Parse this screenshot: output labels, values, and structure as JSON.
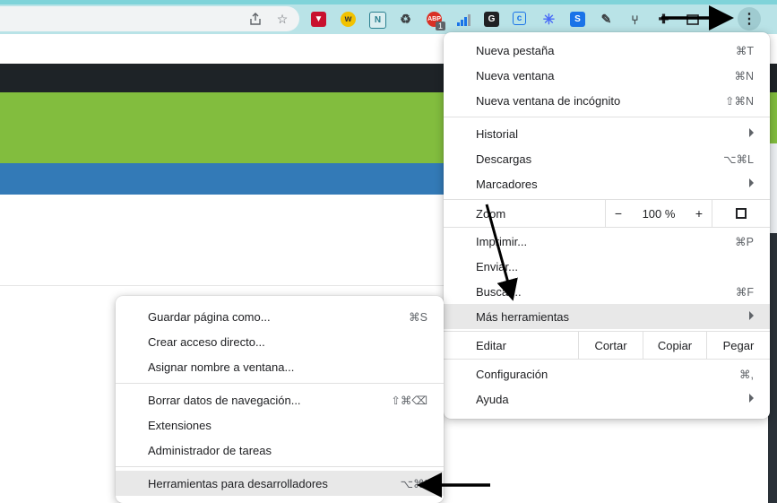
{
  "toolbar": {
    "share_icon": "share-icon",
    "bookmark_icon": "star-icon",
    "extension_badge": "1",
    "menu_icon": "⋮"
  },
  "main_menu": {
    "new_tab": {
      "label": "Nueva pestaña",
      "shortcut": "⌘T"
    },
    "new_window": {
      "label": "Nueva ventana",
      "shortcut": "⌘N"
    },
    "incognito": {
      "label": "Nueva ventana de incógnito",
      "shortcut": "⇧⌘N"
    },
    "history": {
      "label": "Historial"
    },
    "downloads": {
      "label": "Descargas",
      "shortcut": "⌥⌘L"
    },
    "bookmarks": {
      "label": "Marcadores"
    },
    "zoom": {
      "label": "Zoom",
      "minus": "−",
      "value": "100 %",
      "plus": "+"
    },
    "print": {
      "label": "Imprimir...",
      "shortcut": "⌘P"
    },
    "cast": {
      "label": "Enviar..."
    },
    "find": {
      "label": "Buscar...",
      "shortcut": "⌘F"
    },
    "more_tools": {
      "label": "Más herramientas"
    },
    "edit": {
      "label": "Editar",
      "cut": "Cortar",
      "copy": "Copiar",
      "paste": "Pegar"
    },
    "settings": {
      "label": "Configuración",
      "shortcut": "⌘,"
    },
    "help": {
      "label": "Ayuda"
    }
  },
  "sub_menu": {
    "save_page": {
      "label": "Guardar página como...",
      "shortcut": "⌘S"
    },
    "create_shortcut": {
      "label": "Crear acceso directo..."
    },
    "name_window": {
      "label": "Asignar nombre a ventana..."
    },
    "clear_data": {
      "label": "Borrar datos de navegación...",
      "shortcut": "⇧⌘⌫"
    },
    "extensions": {
      "label": "Extensiones"
    },
    "task_manager": {
      "label": "Administrador de tareas"
    },
    "dev_tools": {
      "label": "Herramientas para desarrolladores",
      "shortcut": "⌥⌘I"
    }
  },
  "colors": {
    "toolbar": "#b9e3e7",
    "green_band": "#82bd3e",
    "blue_band": "#337ab7",
    "dark_band": "#1e2327",
    "highlight": "#e8e8e8"
  }
}
